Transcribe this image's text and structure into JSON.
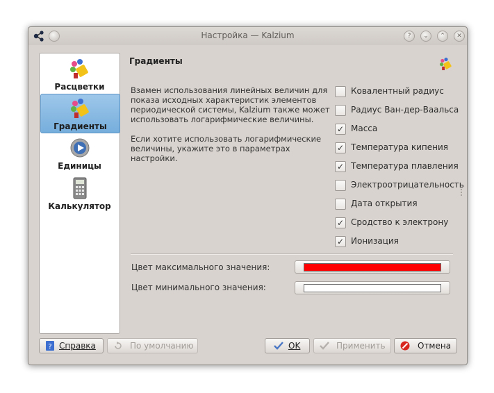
{
  "window": {
    "title": "Настройка — Kalzium"
  },
  "sidebar": {
    "items": [
      {
        "label": "Расцветки",
        "selected": false,
        "icon": "palette-icon"
      },
      {
        "label": "Градиенты",
        "selected": true,
        "icon": "palette-icon"
      },
      {
        "label": "Единицы",
        "selected": false,
        "icon": "gear-icon"
      },
      {
        "label": "Калькулятор",
        "selected": false,
        "icon": "calculator-icon"
      }
    ]
  },
  "page": {
    "title": "Градиенты",
    "description1": "Взамен использования линейных величин для показа исходных характеристик элементов периодической системы, Kalzium также может использовать логарифмические величины.",
    "description2": "Если хотите использовать логарифмические величины, укажите это в параметрах настройки."
  },
  "options": [
    {
      "label": "Ковалентный радиус",
      "checked": false
    },
    {
      "label": "Радиус Ван-дер-Ваальса",
      "checked": false
    },
    {
      "label": "Масса",
      "checked": true
    },
    {
      "label": "Температура кипения",
      "checked": true
    },
    {
      "label": "Температура плавления",
      "checked": true
    },
    {
      "label": "Электроотрицательность",
      "checked": false
    },
    {
      "label": "Дата открытия",
      "checked": false
    },
    {
      "label": "Сродство к электрону",
      "checked": true
    },
    {
      "label": "Ионизация",
      "checked": true
    }
  ],
  "colors": {
    "max_label": "Цвет максимального значения:",
    "max_color": "#ff0000",
    "min_label": "Цвет минимального значения:",
    "min_color": "#ffffff"
  },
  "buttons": {
    "help": "Справка",
    "defaults": "По умолчанию",
    "ok": "OK",
    "apply": "Применить",
    "cancel": "Отмена"
  },
  "accent_color": "#7fb3df",
  "check_mark": "✓"
}
